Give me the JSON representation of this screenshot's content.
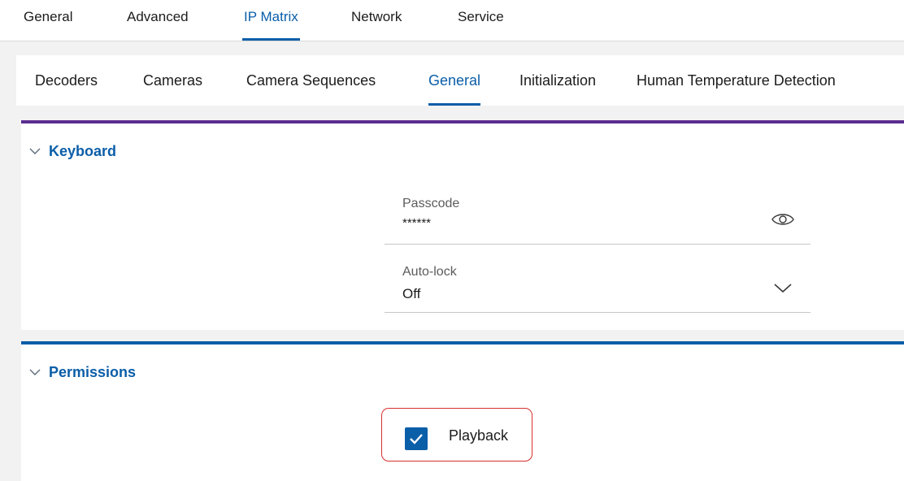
{
  "top_tabs": [
    {
      "label": "General",
      "active": false
    },
    {
      "label": "Advanced",
      "active": false
    },
    {
      "label": "IP Matrix",
      "active": true
    },
    {
      "label": "Network",
      "active": false
    },
    {
      "label": "Service",
      "active": false
    }
  ],
  "sub_tabs": [
    {
      "label": "Decoders",
      "active": false
    },
    {
      "label": "Cameras",
      "active": false
    },
    {
      "label": "Camera Sequences",
      "active": false
    },
    {
      "label": "General",
      "active": true
    },
    {
      "label": "Initialization",
      "active": false
    },
    {
      "label": "Human Temperature Detection",
      "active": false
    }
  ],
  "keyboard": {
    "title": "Keyboard",
    "passcode": {
      "label": "Passcode",
      "value": "******",
      "icon": "eye-icon"
    },
    "autolock": {
      "label": "Auto-lock",
      "value": "Off",
      "icon": "chevron-down-icon"
    }
  },
  "permissions": {
    "title": "Permissions",
    "playback": {
      "label": "Playback",
      "checked": true
    }
  },
  "colors": {
    "accent": "#0b5ea8",
    "keyboard_border": "#5b2d91",
    "highlight": "#d7312e"
  }
}
